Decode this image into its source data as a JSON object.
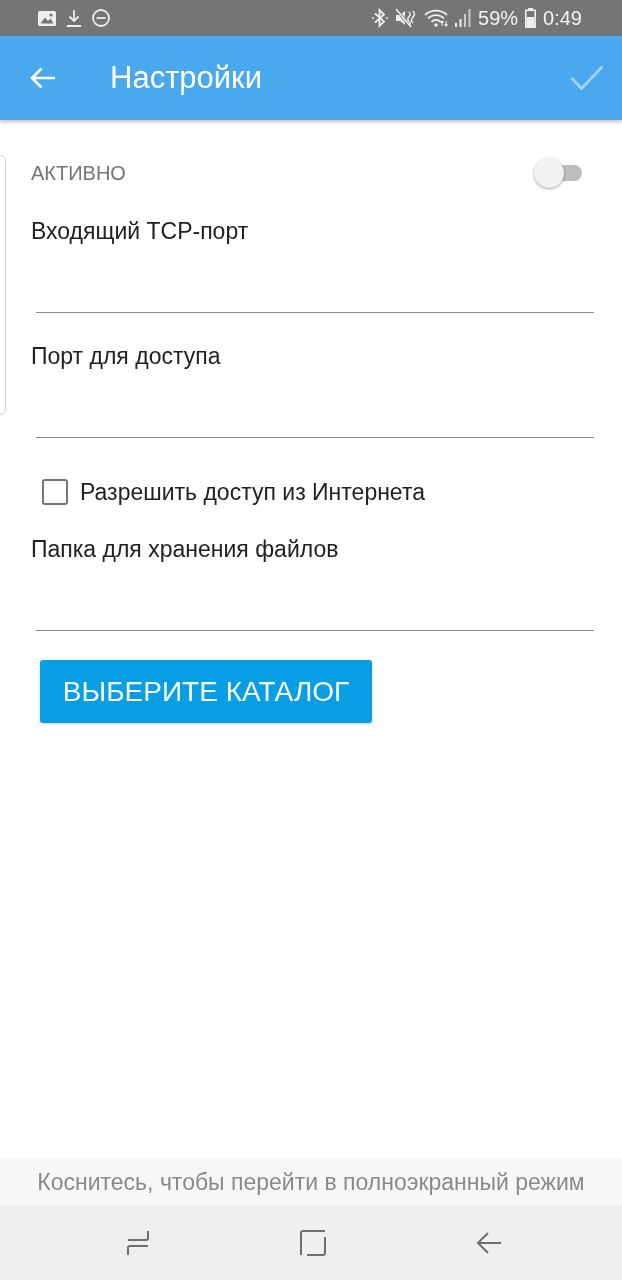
{
  "status_bar": {
    "battery": "59%",
    "time": "0:49"
  },
  "app_bar": {
    "title": "Настройки",
    "confirm": {
      "disabled": true
    }
  },
  "settings": [
    {
      "kind": "toggle",
      "label": "АКТИВНО",
      "on": false
    },
    {
      "kind": "field",
      "label": "Входящий TCP-порт"
    },
    {
      "kind": "field",
      "label": "Порт для доступа"
    },
    {
      "kind": "checkbox",
      "label": "Разрешить доступ из Интернета",
      "checked": false
    },
    {
      "kind": "field",
      "label": "Папка для хранения файлов"
    },
    {
      "kind": "button",
      "label": "ВЫБЕРИТЕ КАТАЛОГ"
    }
  ],
  "fullscreen_hint": "Коснитесь, чтобы перейти в полноэкранный режим"
}
